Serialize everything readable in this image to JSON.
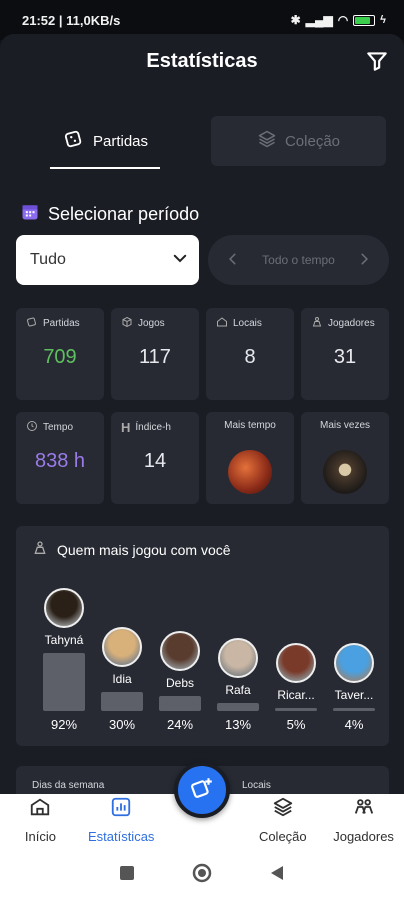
{
  "status": {
    "time": "21:52 | 11,0KB/s",
    "battery_percent": 80
  },
  "header": {
    "title": "Estatísticas"
  },
  "tabs": [
    {
      "label": "Partidas",
      "active": true
    },
    {
      "label": "Coleção",
      "active": false
    }
  ],
  "period": {
    "title": "Selecionar período",
    "select_value": "Tudo",
    "range_label": "Todo o tempo"
  },
  "cards": {
    "partidas": {
      "label": "Partidas",
      "value": "709",
      "color": "#5fbf5f"
    },
    "jogos": {
      "label": "Jogos",
      "value": "117"
    },
    "locais": {
      "label": "Locais",
      "value": "8"
    },
    "jogadores": {
      "label": "Jogadores",
      "value": "31"
    },
    "tempo": {
      "label": "Tempo",
      "value": "838 h",
      "color": "#9a7be8"
    },
    "indice": {
      "label": "Índice-h",
      "value": "14"
    },
    "mais_tempo": {
      "label": "Mais tempo"
    },
    "mais_vezes": {
      "label": "Mais vezes"
    }
  },
  "players_section": {
    "title": "Quem mais jogou com você",
    "players": [
      {
        "name": "Tahyná",
        "pct": "92%",
        "value": 92
      },
      {
        "name": "Idia",
        "pct": "30%",
        "value": 30
      },
      {
        "name": "Debs",
        "pct": "24%",
        "value": 24
      },
      {
        "name": "Rafa",
        "pct": "13%",
        "value": 13
      },
      {
        "name": "Ricar...",
        "pct": "5%",
        "value": 5
      },
      {
        "name": "Taver...",
        "pct": "4%",
        "value": 4
      }
    ]
  },
  "peek": {
    "left": "Dias da semana",
    "right": "Locais"
  },
  "nav": [
    {
      "label": "Início",
      "icon": "home-icon",
      "active": false
    },
    {
      "label": "Estatísticas",
      "icon": "chart-icon",
      "active": true
    },
    {
      "label": "",
      "icon": "",
      "active": false
    },
    {
      "label": "Coleção",
      "icon": "layers-icon",
      "active": false
    },
    {
      "label": "Jogadores",
      "icon": "meeples-icon",
      "active": false
    }
  ]
}
